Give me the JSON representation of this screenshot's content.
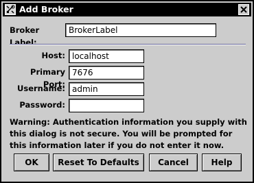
{
  "window": {
    "title": "Add Broker"
  },
  "form": {
    "broker_label": {
      "label": "Broker Label:",
      "value": "BrokerLabel"
    },
    "host": {
      "label": "Host:",
      "value": "localhost"
    },
    "primary_port": {
      "label": "Primary Port:",
      "value": "7676"
    },
    "username": {
      "label": "Username:",
      "value": "admin"
    },
    "password": {
      "label": "Password:",
      "value": ""
    }
  },
  "warning": {
    "line1": "Warning: Authentication information you supply with",
    "line2": "this dialog is not secure. You will be prompted for",
    "line3": "this information later if you do not enter it now."
  },
  "buttons": {
    "ok": "OK",
    "reset": "Reset To Defaults",
    "cancel": "Cancel",
    "help": "Help"
  }
}
